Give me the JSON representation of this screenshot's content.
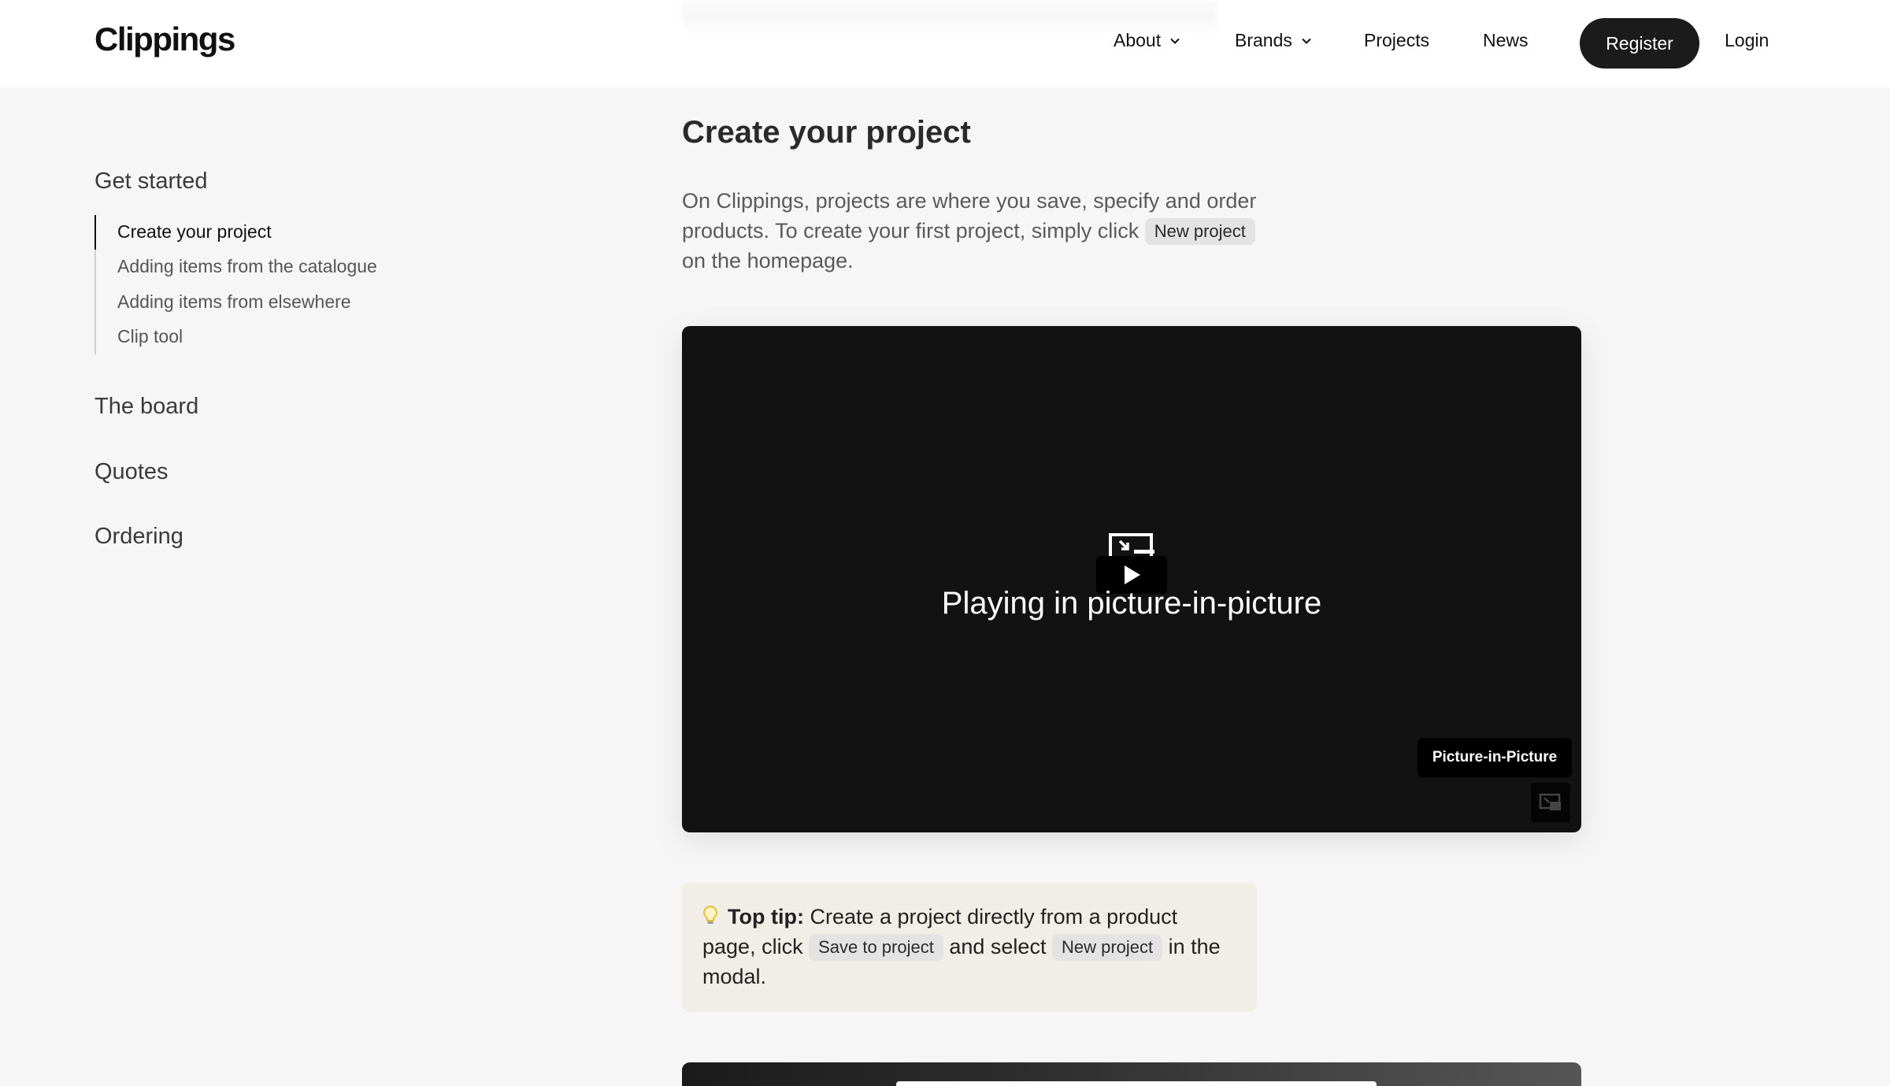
{
  "header": {
    "logo": "Clippings",
    "nav": {
      "about": "About",
      "brands": "Brands",
      "projects": "Projects",
      "news": "News"
    },
    "register": "Register",
    "login": "Login"
  },
  "sidebar": {
    "sections": [
      "Get started",
      "The board",
      "Quotes",
      "Ordering"
    ],
    "get_started_items": [
      "Create your project",
      "Adding items from the catalogue",
      "Adding items from elsewhere",
      "Clip tool"
    ],
    "active_item": "Create your project"
  },
  "main": {
    "title": "Create your project",
    "intro_before": "On Clippings, projects are where you save, specify and order products. To create your first project, simply click",
    "intro_chip": "New project",
    "intro_after": "on the homepage.",
    "video": {
      "status_text": "Playing in picture-in-picture",
      "pip_label": "Picture-in-Picture",
      "icons": [
        "picture-in-picture-icon",
        "play-icon",
        "pip-toggle-icon"
      ]
    },
    "tip": {
      "icon": "lightbulb-icon",
      "label": "Top tip:",
      "text1": "Create a project directly from a product page, click",
      "chip1": "Save to project",
      "text2": "and select",
      "chip2": "New project",
      "text3": "in the modal."
    }
  },
  "colors": {
    "background": "#f6f6f6",
    "header": "#ffffff",
    "register_button": "#1b1b1b",
    "video_background": "#121212",
    "tip_background": "#f1ede7",
    "chip_background": "#e3e3e3"
  }
}
